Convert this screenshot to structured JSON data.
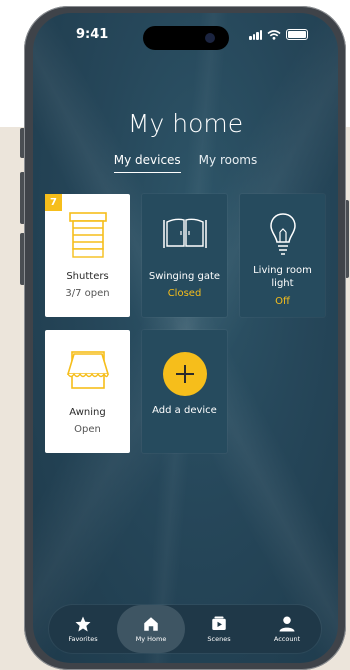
{
  "status_bar": {
    "time": "9:41"
  },
  "page": {
    "title": "My home"
  },
  "tabs": [
    {
      "label": "My devices",
      "active": true
    },
    {
      "label": "My rooms",
      "active": false
    }
  ],
  "devices": [
    {
      "name": "Shutters",
      "status": "3/7 open",
      "badge": "7",
      "icon": "shutter-icon"
    },
    {
      "name": "Swinging gate",
      "status": "Closed",
      "icon": "gate-icon"
    },
    {
      "name": "Living room light",
      "status": "Off",
      "icon": "lightbulb-icon"
    },
    {
      "name": "Awning",
      "status": "Open",
      "icon": "awning-icon"
    }
  ],
  "add_device": {
    "label": "Add a device",
    "icon": "plus-icon"
  },
  "nav": [
    {
      "label": "Favorites",
      "icon": "star-icon"
    },
    {
      "label": "My Home",
      "icon": "home-icon",
      "active": true
    },
    {
      "label": "Scenes",
      "icon": "scenes-icon"
    },
    {
      "label": "Account",
      "icon": "person-icon"
    }
  ],
  "colors": {
    "accent": "#f6be1b",
    "screen_bg": "#26475a",
    "card_dark": "#264b5e"
  }
}
